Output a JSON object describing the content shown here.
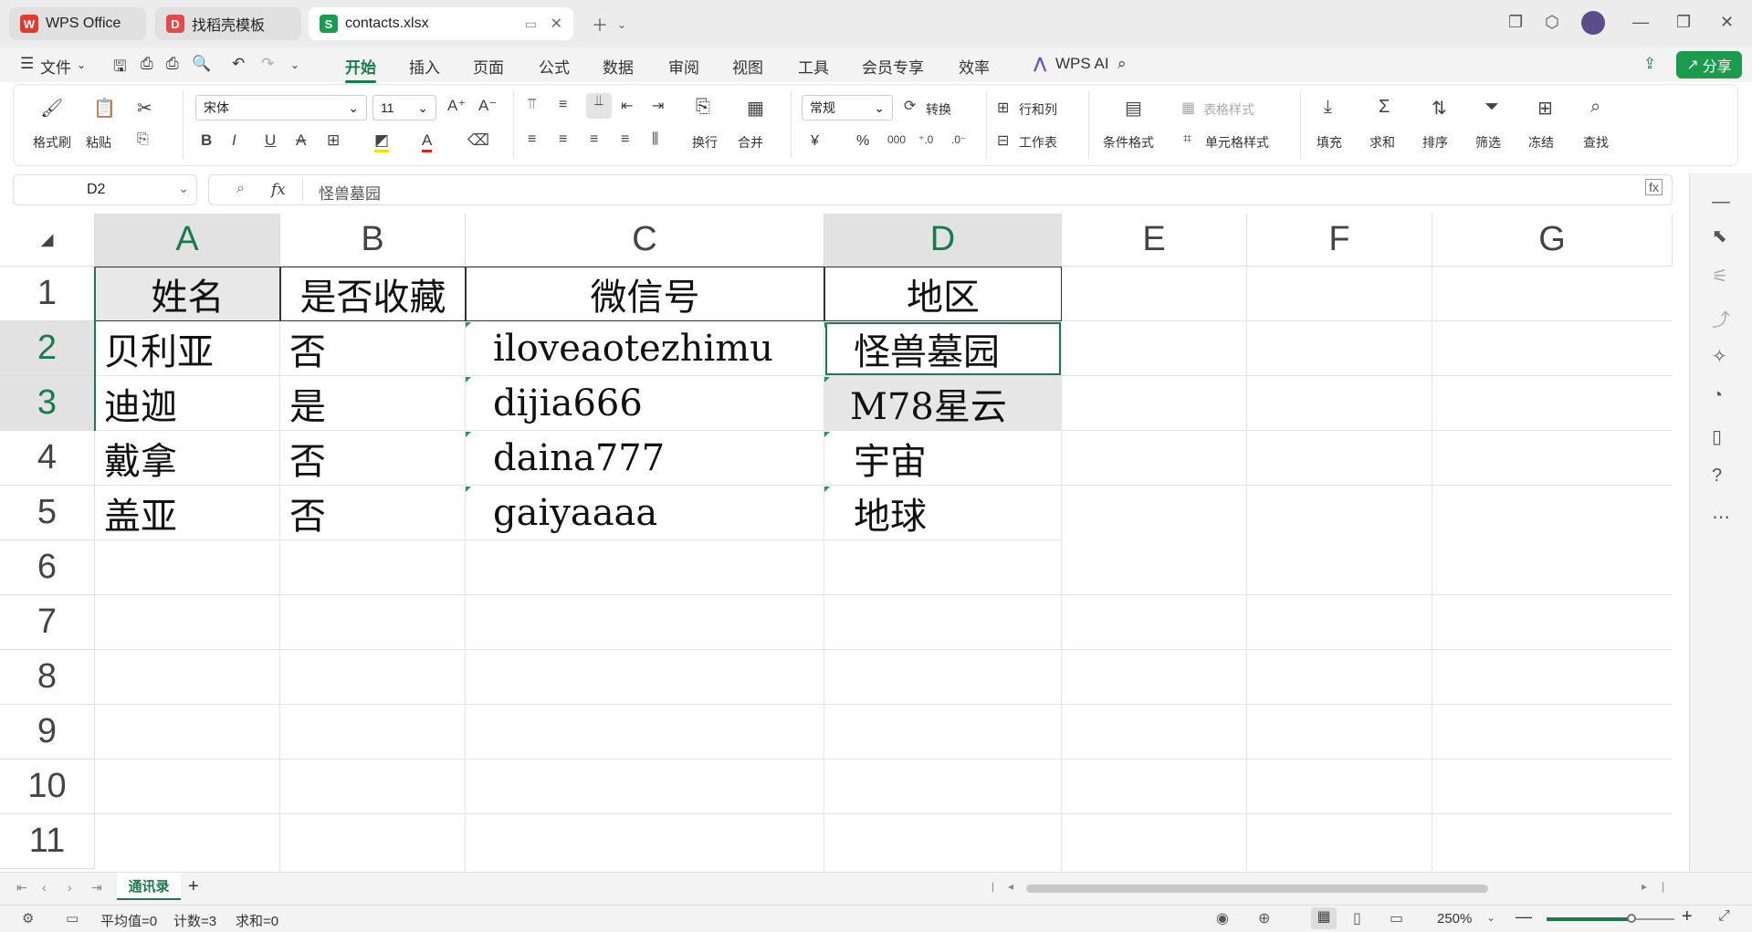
{
  "tabs": [
    {
      "label": "WPS Office",
      "icon": "wps-logo-icon"
    },
    {
      "label": "找稻壳模板",
      "icon": "docer-icon"
    },
    {
      "label": "contacts.xlsx",
      "icon": "spreadsheet-s-icon"
    }
  ],
  "menu": {
    "file": "文件",
    "items": [
      "开始",
      "插入",
      "页面",
      "公式",
      "数据",
      "审阅",
      "视图",
      "工具",
      "会员专享",
      "效率"
    ],
    "wps_ai": "WPS AI",
    "share": "分享"
  },
  "ribbon": {
    "format_painter": "格式刷",
    "paste": "粘贴",
    "font_name": "宋体",
    "font_size": "11",
    "wrap": "换行",
    "merge": "合并",
    "number_format": "常规",
    "convert": "转换",
    "row_col": "行和列",
    "worksheet": "工作表",
    "cond_format": "条件格式",
    "table_style": "表格样式",
    "cell_style": "单元格样式",
    "fill": "填充",
    "sum": "求和",
    "sort": "排序",
    "filter": "筛选",
    "freeze": "冻结",
    "find": "查找",
    "currency": "¥",
    "percent": "%"
  },
  "formula_bar": {
    "cell_ref": "D2",
    "fx": "fx",
    "value": "怪兽墓园"
  },
  "columns": [
    "A",
    "B",
    "C",
    "D",
    "E",
    "F",
    "G"
  ],
  "rows": [
    "1",
    "2",
    "3",
    "4",
    "5",
    "6",
    "7",
    "8",
    "9",
    "10",
    "11"
  ],
  "table": {
    "headers": [
      "姓名",
      "是否收藏",
      "微信号",
      "地区"
    ],
    "data": [
      [
        "贝利亚",
        "否",
        "iloveaotezhimu",
        "怪兽墓园"
      ],
      [
        "迪迦",
        "是",
        "dijia666",
        "M78星云"
      ],
      [
        "戴拿",
        "否",
        "daina777",
        "宇宙"
      ],
      [
        "盖亚",
        "否",
        "gaiyaaaa",
        "地球"
      ]
    ]
  },
  "sheet_tab": "通讯录",
  "status": {
    "average": "平均值=0",
    "count": "计数=3",
    "sum": "求和=0",
    "zoom": "250%"
  },
  "accent_color": "#1a7a4c"
}
